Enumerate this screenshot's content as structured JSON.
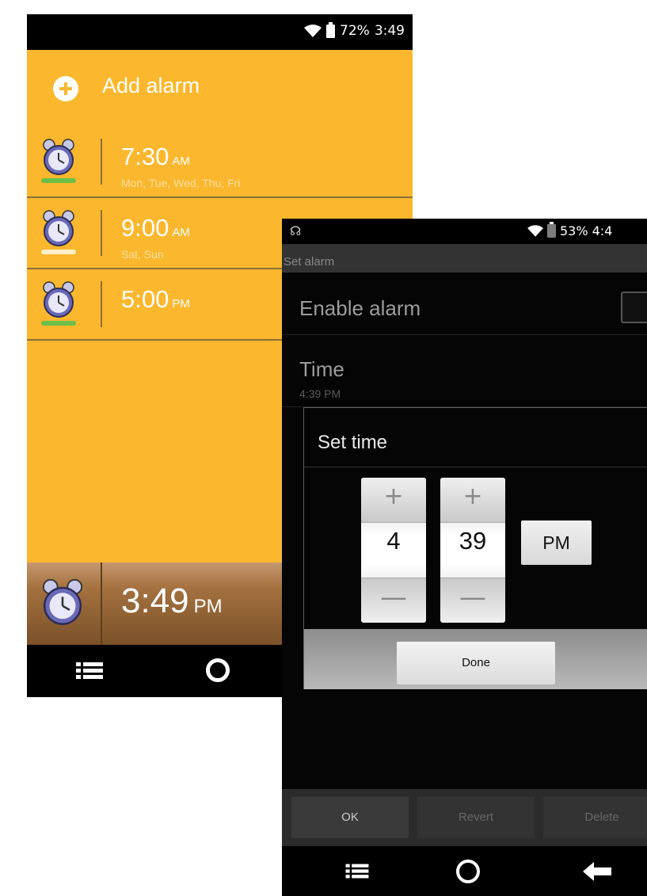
{
  "alarm_list": {
    "status_bar": {
      "battery": "72%",
      "time": "3:49"
    },
    "add_alarm_label": "Add alarm",
    "alarms": [
      {
        "time": "7:30",
        "ampm": "AM",
        "days": "Mon, Tue, Wed, Thu, Fri",
        "enabled": true
      },
      {
        "time": "9:00",
        "ampm": "AM",
        "days": "Sat, Sun",
        "enabled": false
      },
      {
        "time": "5:00",
        "ampm": "PM",
        "days": "",
        "enabled": true
      }
    ],
    "current_time": {
      "time": "3:49",
      "ampm": "PM"
    }
  },
  "settings": {
    "status_bar": {
      "battery": "53%",
      "time": "4:4"
    },
    "screen_title": "Set alarm",
    "enable_alarm_label": "Enable alarm",
    "time_label": "Time",
    "time_value": "4:39 PM",
    "dialog": {
      "title": "Set time",
      "hour": "4",
      "minute": "39",
      "ampm": "PM",
      "plus_glyph": "+",
      "minus_glyph": "—",
      "done_label": "Done"
    },
    "buttons": {
      "ok": "OK",
      "revert": "Revert",
      "delete": "Delete"
    }
  },
  "colors": {
    "alarm_bg": "#fbb72d",
    "enabled": "#6bbf4a",
    "disabled": "#fdf0c8",
    "dark_bg": "#050505"
  }
}
